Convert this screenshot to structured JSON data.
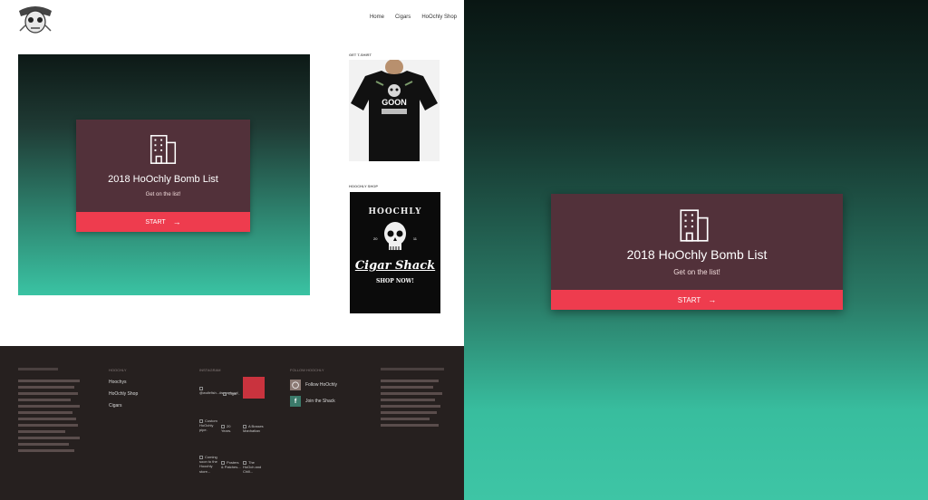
{
  "nav": {
    "items": [
      "Home",
      "Cigars",
      "HoOchly Shop"
    ]
  },
  "bomb_card": {
    "title": "2018 HoOchly Bomb List",
    "subtitle": "Get on the list!",
    "button_label": "START",
    "arrow_glyph": "→",
    "icon": "building-icon"
  },
  "sidebar": {
    "shirt_heading": "GET T-SHIRT",
    "shop_heading": "HOOCHLY SHOP",
    "shirt_graphic_text": "GOON",
    "banner": {
      "brand": "HOOCHLY",
      "year_left": "20",
      "year_right": "11",
      "name": "Cigar Shack",
      "cta": "SHOP NOW!"
    }
  },
  "footer": {
    "col2_heading": "HOOCHLY",
    "col2_links": [
      "Hoochys",
      "HoOchly Shop",
      "Cigars"
    ],
    "col3_heading": "INSTAGRAM",
    "col4_heading": "FOLLOW HOOCHLY",
    "social": [
      {
        "label": "Follow HoOchly",
        "icon": "instagram-icon"
      },
      {
        "label": "Join the Shack",
        "icon": "facebook-icon"
      }
    ],
    "instagram_alts": [
      "@woltrfish...#superbowl",
      "Cigar...",
      "Custom HoOchly pipe.",
      "20 Years.",
      "A Bosses Manhattan",
      "Coming soon to the Hoochly store...",
      "Posters & Patches...",
      "The HoOch and Chill..."
    ]
  },
  "colors": {
    "card_bg": "#52313a",
    "button_bg": "#ee3c4e",
    "gradient_top": "#0d1916",
    "gradient_bottom": "#3ac3a3",
    "footer_bg": "#26201f"
  }
}
